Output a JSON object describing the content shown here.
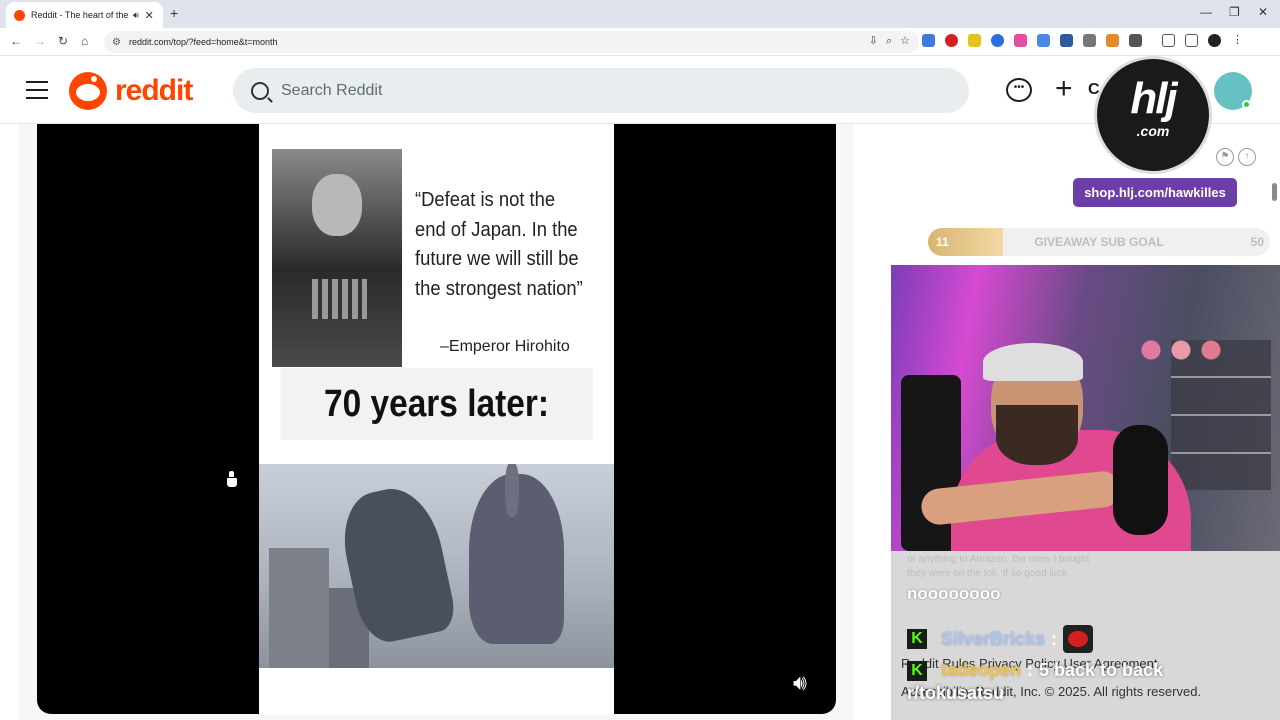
{
  "browser": {
    "tab_title": "Reddit - The heart of the in",
    "new_tab": "+",
    "url": "reddit.com/top/?feed=home&t=month"
  },
  "header": {
    "logo_text": "reddit",
    "search_placeholder": "Search Reddit",
    "create_partial": "C"
  },
  "post": {
    "quote": "“Defeat is not the end of Japan. In the future we will still be the strongest nation”",
    "attribution": "–Emperor Hirohito",
    "caption": "70 years later:"
  },
  "overlay": {
    "brand_big": "hlj",
    "brand_domain": ".com",
    "shop_link": "shop.hlj.com/hawkilles",
    "goal": {
      "current": "11",
      "label": "GIVEAWAY SUB GOAL",
      "target": "50",
      "progress_fraction": 0.22
    },
    "chat": {
      "faded_line_1": "or anything to Amazon. the ones I bought",
      "faded_line_2": "they were on the tok. If so good luck",
      "message_big": "noooooooo",
      "user1": "SilverBricks",
      "user1_sep": ":",
      "user2": "tadeopen",
      "user2_sep": ":",
      "user2_text": "5 back to back",
      "subreddit": "r/tokusatsu",
      "footer_links": "Reddit Rules   Privacy Policy   User Agreement",
      "footer_copy": "Accessibility   Reddit, Inc. © 2025. All rights reserved."
    }
  },
  "colors": {
    "reddit_orange": "#ff4500",
    "shop_purple": "#6c3fa8",
    "kick_green": "#53fc18"
  }
}
